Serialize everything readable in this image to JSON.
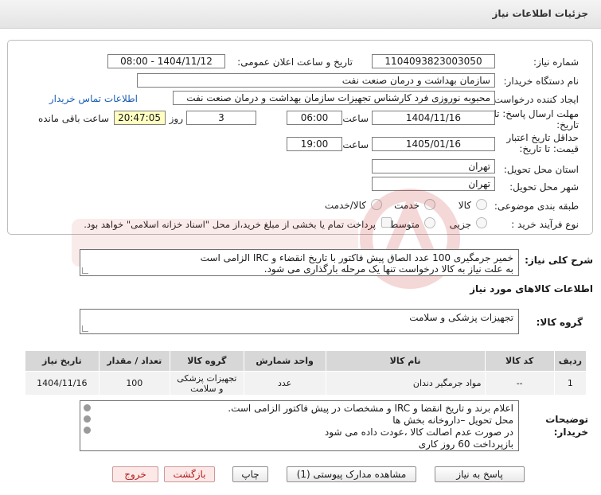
{
  "header": {
    "title": "جزئیات اطلاعات نیاز"
  },
  "form": {
    "need_number_label": "شماره نیاز:",
    "need_number": "1104093823003050",
    "announce_label": "تاریخ و ساعت اعلان عمومی:",
    "announce_value": "1404/11/12 - 08:00",
    "buyer_org_label": "نام دستگاه خریدار:",
    "buyer_org": "سازمان بهداشت و درمان صنعت نفت",
    "creator_label": "ایجاد کننده درخواست:",
    "creator": "محبوبه نوروزی فرد کارشناس تجهیزات سازمان بهداشت و درمان صنعت نفت",
    "contact_link": "اطلاعات تماس خریدار",
    "deadline_label_1": "مهلت ارسال پاسخ: تا",
    "deadline_label_2": "تاریخ:",
    "deadline_date": "1404/11/16",
    "time_label": "ساعت",
    "deadline_time": "06:00",
    "days_value": "3",
    "days_label": "روز و",
    "remaining_time": "20:47:05",
    "remaining_label": "ساعت باقی مانده",
    "validity_label_1": "حداقل تاریخ اعتبار",
    "validity_label_2": "قیمت: تا تاریخ:",
    "validity_date": "1405/01/16",
    "validity_time": "19:00",
    "province_label": "استان محل تحویل:",
    "province": "تهران",
    "city_label": "شهر محل تحویل:",
    "city": "تهران",
    "category_label": "طبقه بندی موضوعی:",
    "category_options": [
      "کالا",
      "خدمت",
      "کالا/خدمت"
    ],
    "process_label": "نوع فرآیند خرید :",
    "process_options": [
      "جزیی",
      "متوسط"
    ],
    "payment_note": "پرداخت تمام یا بخشی از مبلغ خرید،از محل \"اسناد خزانه اسلامی\" خواهد بود."
  },
  "description": {
    "label": "شرح کلی نیاز:",
    "line1": "خمیر جرمگیری 100 عدد الصاق پیش فاکتور با تاریخ انقضاء و IRC الزامی است",
    "line2": "به علت نیاز به کالا درخواست تنها یک مرحله بارگذاری می شود."
  },
  "goods": {
    "section_title": "اطلاعات کالاهای مورد نیاز",
    "group_label": "گروه کالا:",
    "group_value": "تجهیزات پزشکی و سلامت",
    "table": {
      "headers": [
        "ردیف",
        "کد کالا",
        "نام کالا",
        "واحد شمارش",
        "گروه کالا",
        "تعداد / مقدار",
        "تاریخ نیاز"
      ],
      "rows": [
        [
          "1",
          "--",
          "مواد جرمگیر دندان",
          "عدد",
          "تجهیزات پزشکی و سلامت",
          "100",
          "1404/11/16"
        ]
      ]
    }
  },
  "buyer_notes": {
    "label_1": "توضیحات",
    "label_2": "خریدار:",
    "lines": [
      "اعلام برند و تاریخ انقضا  و IRC  و مشخصات در پیش فاکتور الزامی است.",
      "محل تحویل –داروخانه بخش ها",
      "در صورت عدم اصالت کالا ،عودت داده می شود",
      "بازپرداخت 60 روز کاری"
    ]
  },
  "buttons": {
    "reply": "پاسخ به نیاز",
    "attachments": "مشاهده مدارک پیوستی (1)",
    "print": "چاپ",
    "back": "بازگشت",
    "exit": "خروج"
  }
}
